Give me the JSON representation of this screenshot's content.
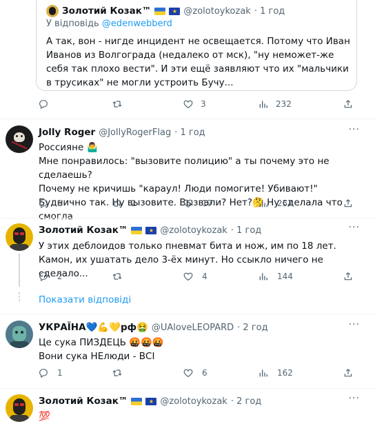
{
  "tweets": {
    "quoted": {
      "name": "Золотий Козак™",
      "handle": "@zolotoykozak",
      "time": "· 1 год",
      "reply_prefix": "У відповідь",
      "reply_to": "@edenwebberd",
      "text": "А так, вон - нигде инцидент не освещается. Потому что Иван Иванов из Волгограда (недалеко от мск), \"ну неможет-же себя так плохо вести\". И эти ещё заявляют что их \"мальчики в трусиках\" не могли устроить Бучу...",
      "likes": "3",
      "views": "232"
    },
    "t1": {
      "name": "Jolly Roger",
      "handle": "@JollyRogerFlag",
      "time": "· 1 год",
      "line1": "Россияне 🤷‍♂️",
      "line2": "Мне понравилось: \"вызовите полицию\" а ты почему это не сделаешь?",
      "line3": "Почему не кричишь \"караул! Люди помогите! Убивают!\"",
      "line4": "Буднично так. Ну вызовите. Вызвали? Нет?🤔 Ну сделала что смогла",
      "replies": "1",
      "retweets": "2",
      "likes": "17",
      "views": "257"
    },
    "t2": {
      "name": "Золотий Козак™",
      "handle": "@zolotoykozak",
      "time": "· 1 год",
      "text": "У этих деблоидов только пневмат бита и нож, им по 18 лет. Камон, их ушатать дело 3-ёх минут. Но ссыкло ничего не сделало...",
      "replies": "2",
      "likes": "4",
      "views": "144"
    },
    "show_replies": "Показати відповіді",
    "t3": {
      "name": "УКРАЇНА💙💪💛рф🤮",
      "handle": "@UAloveLEOPARD",
      "time": "· 2 год",
      "line1": "Це сука ПИЗДЕЦЬ 🤬🤬🤬",
      "line2": "Вони сука НЕлюди - ВСІ",
      "replies": "1",
      "likes": "6",
      "views": "162"
    },
    "t4": {
      "name": "Золотий Козак™",
      "handle": "@zolotoykozak",
      "time": "· 2 год",
      "text": "💯"
    }
  },
  "colors": {
    "accent": "#1d9bf0",
    "muted": "#536471",
    "border": "#cfd9de"
  },
  "icons": [
    "reply-icon",
    "retweet-icon",
    "like-icon",
    "views-icon",
    "share-icon",
    "more-icon",
    "ukraine-flag-icon",
    "eu-flag-icon"
  ]
}
